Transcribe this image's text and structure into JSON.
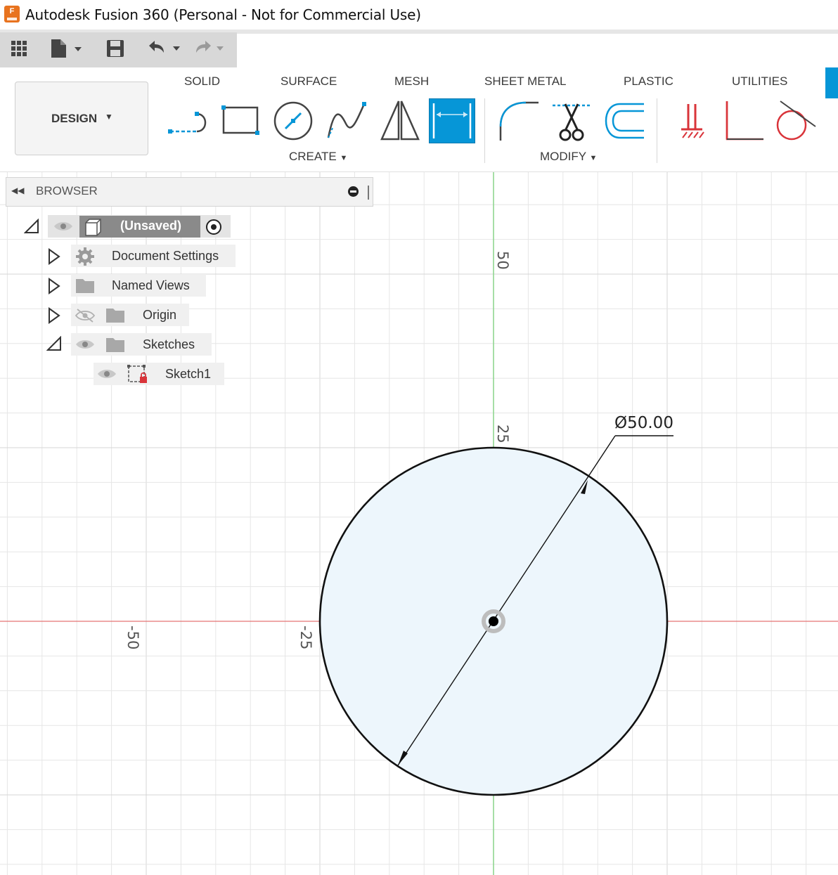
{
  "window": {
    "title": "Autodesk Fusion 360 (Personal - Not for Commercial Use)",
    "logo_letter": "F"
  },
  "workspace": {
    "label": "DESIGN"
  },
  "ribbon": {
    "tabs": [
      "SOLID",
      "SURFACE",
      "MESH",
      "SHEET METAL",
      "PLASTIC",
      "UTILITIES"
    ],
    "groups": {
      "create": "CREATE",
      "modify": "MODIFY"
    }
  },
  "browser": {
    "title": "BROWSER",
    "root": "(Unsaved)",
    "items": [
      {
        "label": "Document Settings"
      },
      {
        "label": "Named Views"
      },
      {
        "label": "Origin"
      },
      {
        "label": "Sketches"
      },
      {
        "label": "Sketch1"
      }
    ]
  },
  "canvas": {
    "axis_labels": {
      "y50": "50",
      "y25": "25",
      "xm50": "-50",
      "xm25": "-25"
    },
    "dimension": "Ø50.00"
  },
  "colors": {
    "accent": "#0696d7",
    "sketch_fill": "#edf6fc",
    "x_axis": "#e57373",
    "y_axis": "#8fd68f",
    "constraint_red": "#d9343a"
  }
}
